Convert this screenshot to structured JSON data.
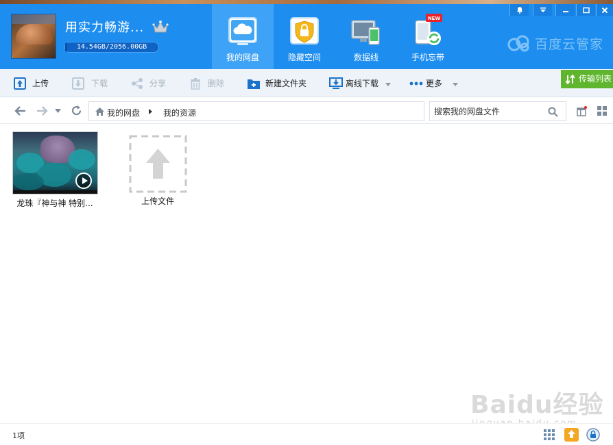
{
  "header": {
    "username": "用实力畅游...",
    "quota_text": "14.54GB/2056.00GB",
    "quota_used_fraction": 0.0071,
    "brand": "百度云管家",
    "tabs": [
      {
        "label": "我的网盘",
        "icon": "cloud-drive-icon",
        "active": true
      },
      {
        "label": "隐藏空间",
        "icon": "lock-icon",
        "active": false
      },
      {
        "label": "数据线",
        "icon": "devices-icon",
        "active": false
      },
      {
        "label": "手机忘带",
        "icon": "phone-sync-icon",
        "active": false,
        "badge": "NEW"
      }
    ],
    "window_buttons": [
      "bell-icon",
      "dropdown-icon",
      "minimize-icon",
      "maximize-icon",
      "close-icon"
    ]
  },
  "toolbar": {
    "upload": "上传",
    "download": "下载",
    "share": "分享",
    "delete": "删除",
    "new_folder": "新建文件夹",
    "offline_download": "离线下载",
    "more": "更多",
    "transfer_list": "传输列表"
  },
  "address": {
    "crumb_root": "我的网盘",
    "crumb_current": "我的资源",
    "search_placeholder": "搜索我的网盘文件"
  },
  "files": [
    {
      "name": "龙珠『神与神 特别...",
      "type": "video"
    }
  ],
  "upload_tile": {
    "label": "上传文件"
  },
  "status": {
    "count": "1项"
  },
  "watermark": {
    "main": "Baidu经验",
    "sub": "jingyan.baidu.com"
  },
  "colors": {
    "header_bg": "#1d8ef0",
    "active_tab": "#3ea3f6",
    "transfer_green": "#5fb52d",
    "toolbar_bg": "#eef3f9"
  }
}
